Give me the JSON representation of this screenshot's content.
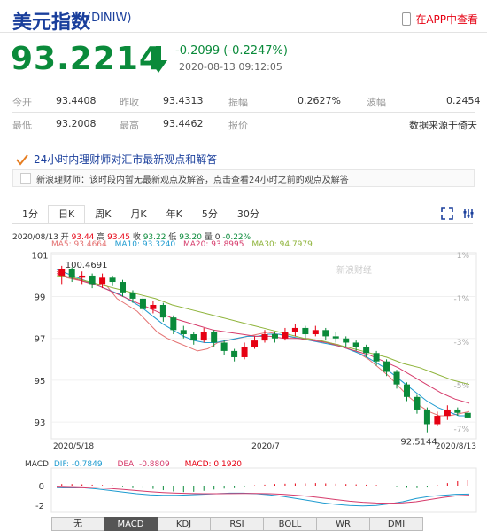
{
  "header": {
    "title": "美元指数",
    "code": "(DINIW)",
    "app_link": "在APP中查看"
  },
  "quote": {
    "price": "93.2214",
    "change": "-0.2099 (-0.2247%)",
    "datetime": "2020-08-13 09:12:05"
  },
  "stats": [
    {
      "label": "今开",
      "value": "93.4408"
    },
    {
      "label": "昨收",
      "value": "93.4313"
    },
    {
      "label": "振幅",
      "value": "0.2627%"
    },
    {
      "label": "波幅",
      "value": "0.2454"
    },
    {
      "label": "最低",
      "value": "93.2008"
    },
    {
      "label": "最高",
      "value": "93.4462"
    },
    {
      "label": "报价",
      "value": ""
    },
    {
      "label": "",
      "value": "数据来源于倚天"
    }
  ],
  "news": {
    "heading": "24小时内理财师对汇市最新观点和解答",
    "text": "新浪理财师：该时段内暂无最新观点及解答，点击查看24小时之前的观点及解答"
  },
  "tabs": [
    "1分",
    "日K",
    "周K",
    "月K",
    "年K",
    "5分",
    "30分"
  ],
  "active_tab": "日K",
  "ohlc_info": {
    "date": "2020/08/13",
    "open_label": "开",
    "open": "93.44",
    "high_label": "高",
    "high": "93.45",
    "close_label": "收",
    "close": "93.22",
    "low_label": "低",
    "low": "93.20",
    "vol_label": "量",
    "vol": "0",
    "change": "-0.22%"
  },
  "ma_info": {
    "ma5": "MA5: 93.4664",
    "ma10": "MA10: 93.3240",
    "ma20": "MA20: 93.8995",
    "ma30": "MA30: 94.7979"
  },
  "watermark": "新浪财经",
  "macd_info": {
    "label": "MACD",
    "dif": "DIF: -0.7849",
    "dea": "DEA: -0.8809",
    "macd": "MACD: 0.1920"
  },
  "bottom_tabs": [
    "无",
    "MACD",
    "KDJ",
    "RSI",
    "BOLL",
    "WR",
    "DMI"
  ],
  "active_bottom_tab": "MACD",
  "colors": {
    "up": "#e60012",
    "down": "#0a8a3a",
    "ma5": "#e47272",
    "ma10": "#1e9bd0",
    "ma20": "#d63b6b",
    "ma30": "#8fb43b",
    "brand": "#1a3f9c"
  },
  "chart_data": {
    "type": "candlestick",
    "y_ticks": [
      "101",
      "99",
      "97",
      "95",
      "93"
    ],
    "pct_ticks": [
      "1%",
      "-1%",
      "-3%",
      "-5%",
      "-7%"
    ],
    "x_ticks": [
      "2020/5/18",
      "2020/7",
      "2020/8/13"
    ],
    "high_label": "100.4691",
    "low_label": "92.5144",
    "macd_ticks": [
      "0",
      "-2"
    ],
    "ylim": [
      92.2,
      101.1
    ],
    "series": [
      {
        "name": "MA5",
        "values": [
          100.2,
          99.9,
          99.8,
          99.7,
          99.6,
          99.5,
          98.9,
          98.6,
          98.3,
          97.8,
          97.3,
          97.0,
          96.8,
          96.6,
          96.4,
          96.5,
          96.8,
          96.9,
          97.0,
          97.1,
          97.2,
          97.3,
          97.2,
          97.1,
          97.0,
          97.0,
          96.9,
          96.8,
          96.7,
          96.5,
          96.3,
          96.0,
          95.6,
          95.2,
          94.7,
          94.2,
          93.8,
          93.5,
          93.3,
          93.3,
          93.4,
          93.5
        ]
      },
      {
        "name": "MA10",
        "values": [
          100.3,
          100.1,
          99.9,
          99.7,
          99.5,
          99.3,
          99.1,
          98.8,
          98.5,
          98.1,
          97.7,
          97.4,
          97.1,
          96.9,
          96.8,
          96.8,
          96.9,
          97.0,
          97.1,
          97.1,
          97.2,
          97.2,
          97.1,
          97.0,
          96.9,
          96.8,
          96.7,
          96.6,
          96.4,
          96.2,
          95.9,
          95.6,
          95.2,
          94.8,
          94.4,
          94.0,
          93.7,
          93.5,
          93.3,
          93.3
        ]
      },
      {
        "name": "MA20",
        "values": [
          100.1,
          99.9,
          99.7,
          99.5,
          99.2,
          98.9,
          98.6,
          98.3,
          98.0,
          97.8,
          97.6,
          97.4,
          97.3,
          97.2,
          97.1,
          97.1,
          97.0,
          97.0,
          96.9,
          96.8,
          96.6,
          96.4,
          96.2,
          95.9,
          95.6,
          95.2,
          94.8,
          94.4,
          94.1,
          93.9
        ]
      },
      {
        "name": "MA30",
        "values": [
          100.0,
          99.9,
          99.7,
          99.5,
          99.3,
          99.1,
          98.9,
          98.6,
          98.4,
          98.2,
          98.0,
          97.8,
          97.6,
          97.4,
          97.2,
          97.0,
          96.9,
          96.7,
          96.5,
          96.3,
          96.1,
          95.8,
          95.6,
          95.3,
          95.0,
          94.8
        ]
      }
    ],
    "candles": [
      [
        100.0,
        100.3,
        100.47,
        99.6
      ],
      [
        100.3,
        99.9,
        100.4,
        99.7
      ],
      [
        99.9,
        100.0,
        100.2,
        99.6
      ],
      [
        100.0,
        99.6,
        100.1,
        99.4
      ],
      [
        99.6,
        99.9,
        100.1,
        99.4
      ],
      [
        99.9,
        99.7,
        100.0,
        99.5
      ],
      [
        99.7,
        99.2,
        99.8,
        99.0
      ],
      [
        99.2,
        98.9,
        99.3,
        98.7
      ],
      [
        98.9,
        98.4,
        99.0,
        98.2
      ],
      [
        98.4,
        98.6,
        98.8,
        98.2
      ],
      [
        98.6,
        98.0,
        98.7,
        97.8
      ],
      [
        98.0,
        97.4,
        98.1,
        97.2
      ],
      [
        97.4,
        97.2,
        97.6,
        97.0
      ],
      [
        97.2,
        96.9,
        97.3,
        96.7
      ],
      [
        96.9,
        97.3,
        97.5,
        96.8
      ],
      [
        97.3,
        96.8,
        97.4,
        96.6
      ],
      [
        96.8,
        96.4,
        96.9,
        96.2
      ],
      [
        96.4,
        96.1,
        96.5,
        95.9
      ],
      [
        96.1,
        96.6,
        96.8,
        96.0
      ],
      [
        96.6,
        96.9,
        97.1,
        96.5
      ],
      [
        96.9,
        97.2,
        97.4,
        96.8
      ],
      [
        97.2,
        97.0,
        97.3,
        96.8
      ],
      [
        97.0,
        97.3,
        97.5,
        96.9
      ],
      [
        97.3,
        97.5,
        97.7,
        97.1
      ],
      [
        97.5,
        97.2,
        97.6,
        97.0
      ],
      [
        97.2,
        97.4,
        97.6,
        97.1
      ],
      [
        97.4,
        97.1,
        97.5,
        96.9
      ],
      [
        97.1,
        97.0,
        97.3,
        96.8
      ],
      [
        97.0,
        96.8,
        97.1,
        96.6
      ],
      [
        96.8,
        96.6,
        96.9,
        96.4
      ],
      [
        96.6,
        96.3,
        96.7,
        96.1
      ],
      [
        96.3,
        95.9,
        96.4,
        95.7
      ],
      [
        95.9,
        95.4,
        96.0,
        95.2
      ],
      [
        95.4,
        94.8,
        95.5,
        94.6
      ],
      [
        94.8,
        94.2,
        94.9,
        94.0
      ],
      [
        94.2,
        93.6,
        94.3,
        93.4
      ],
      [
        93.6,
        92.9,
        93.7,
        92.51
      ],
      [
        92.9,
        93.3,
        93.5,
        92.8
      ],
      [
        93.3,
        93.6,
        93.8,
        93.1
      ],
      [
        93.6,
        93.44,
        93.7,
        93.3
      ],
      [
        93.44,
        93.22,
        93.45,
        93.2
      ]
    ],
    "macd_values": [
      0.05,
      0.05,
      0.04,
      0.03,
      0.02,
      0.01,
      -0.02,
      -0.05,
      -0.08,
      -0.1,
      -0.14,
      -0.18,
      -0.2,
      -0.19,
      -0.16,
      -0.12,
      -0.09,
      -0.05,
      -0.02,
      0.01,
      0.03,
      0.05,
      0.06,
      0.07,
      0.07,
      0.08,
      0.07,
      0.06,
      0.05,
      0.04,
      0.03,
      0.02,
      0.0,
      -0.02,
      -0.04,
      -0.05,
      -0.03,
      0.02,
      0.08,
      0.14,
      0.19
    ],
    "dif_values": [
      -0.1,
      -0.15,
      -0.2,
      -0.3,
      -0.45,
      -0.6,
      -0.75,
      -0.85,
      -0.9,
      -0.9,
      -0.85,
      -0.8,
      -0.75,
      -0.7,
      -0.7,
      -0.75,
      -0.85,
      -1.0,
      -1.2,
      -1.4,
      -1.6,
      -1.75,
      -1.85,
      -1.9,
      -1.85,
      -1.7,
      -1.5,
      -1.2,
      -1.0,
      -0.9,
      -0.8,
      -0.78
    ],
    "dea_values": [
      -0.05,
      -0.08,
      -0.12,
      -0.18,
      -0.26,
      -0.36,
      -0.46,
      -0.56,
      -0.64,
      -0.7,
      -0.73,
      -0.75,
      -0.75,
      -0.74,
      -0.73,
      -0.73,
      -0.75,
      -0.8,
      -0.9,
      -1.0,
      -1.15,
      -1.3,
      -1.45,
      -1.55,
      -1.62,
      -1.63,
      -1.6,
      -1.5,
      -1.3,
      -1.1,
      -0.95,
      -0.88
    ]
  }
}
